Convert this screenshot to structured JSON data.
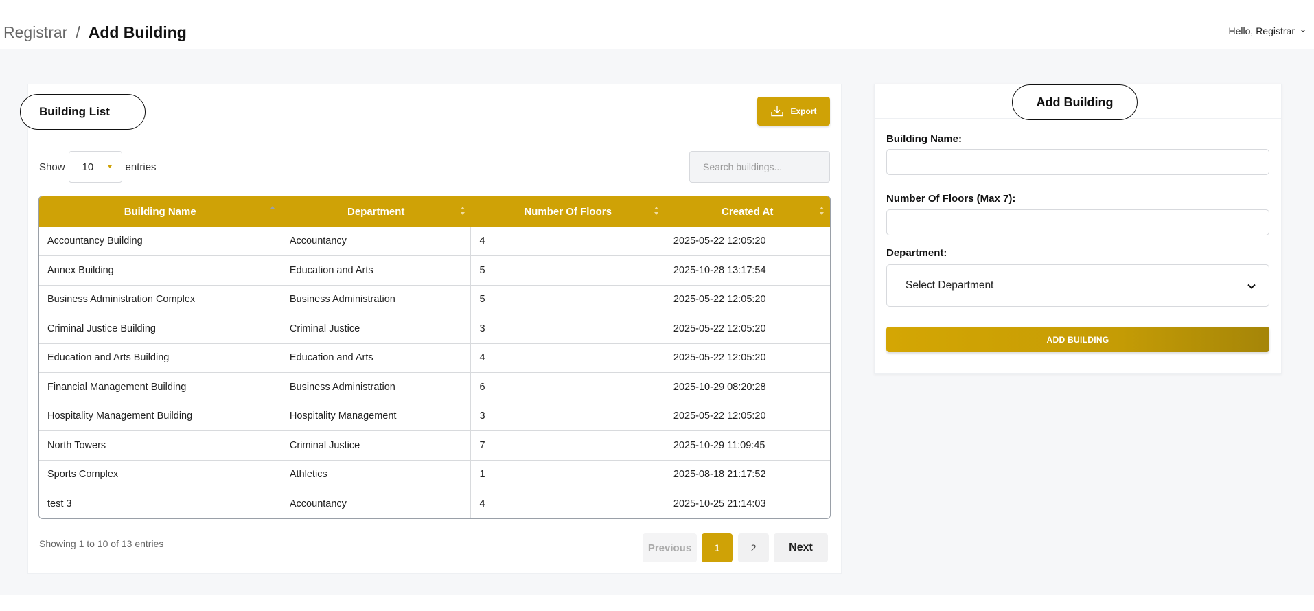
{
  "breadcrumb": {
    "parent": "Registrar",
    "separator": "/",
    "current": "Add Building"
  },
  "user_menu": {
    "greeting": "Hello, Registrar",
    "icon": "chevron-down-icon"
  },
  "building_list": {
    "title": "Building List",
    "export_label": "Export",
    "export_icon": "download-icon",
    "show_label": "Show",
    "entries_value": "10",
    "entries_label": "entries",
    "search_placeholder": "Search buildings...",
    "columns": [
      "Building Name",
      "Department",
      "Number Of Floors",
      "Created At"
    ],
    "sort_state": [
      "ascending",
      "unsorted",
      "unsorted",
      "unsorted"
    ],
    "rows": [
      [
        "Accountancy Building",
        "Accountancy",
        "4",
        "2025-05-22 12:05:20"
      ],
      [
        "Annex Building",
        "Education and Arts",
        "5",
        "2025-10-28 13:17:54"
      ],
      [
        "Business Administration Complex",
        "Business Administration",
        "5",
        "2025-05-22 12:05:20"
      ],
      [
        "Criminal Justice Building",
        "Criminal Justice",
        "3",
        "2025-05-22 12:05:20"
      ],
      [
        "Education and Arts Building",
        "Education and Arts",
        "4",
        "2025-05-22 12:05:20"
      ],
      [
        "Financial Management Building",
        "Business Administration",
        "6",
        "2025-10-29 08:20:28"
      ],
      [
        "Hospitality Management Building",
        "Hospitality Management",
        "3",
        "2025-05-22 12:05:20"
      ],
      [
        "North Towers",
        "Criminal Justice",
        "7",
        "2025-10-29 11:09:45"
      ],
      [
        "Sports Complex",
        "Athletics",
        "1",
        "2025-08-18 21:17:52"
      ],
      [
        "test 3",
        "Accountancy",
        "4",
        "2025-10-25 21:14:03"
      ]
    ],
    "info": "Showing 1 to 10 of 13 entries",
    "pagination": {
      "previous": "Previous",
      "pages": [
        "1",
        "2"
      ],
      "active_page": "1",
      "next": "Next"
    }
  },
  "add_building_form": {
    "title": "Add Building",
    "building_name_label": "Building Name:",
    "building_name_value": "",
    "floors_label": "Number Of Floors (Max 7):",
    "floors_value": "",
    "department_label": "Department:",
    "department_selected": "Select Department",
    "submit_label": "ADD BUILDING"
  },
  "colors": {
    "accent": "#cfa206",
    "background": "#f6f7f9"
  }
}
